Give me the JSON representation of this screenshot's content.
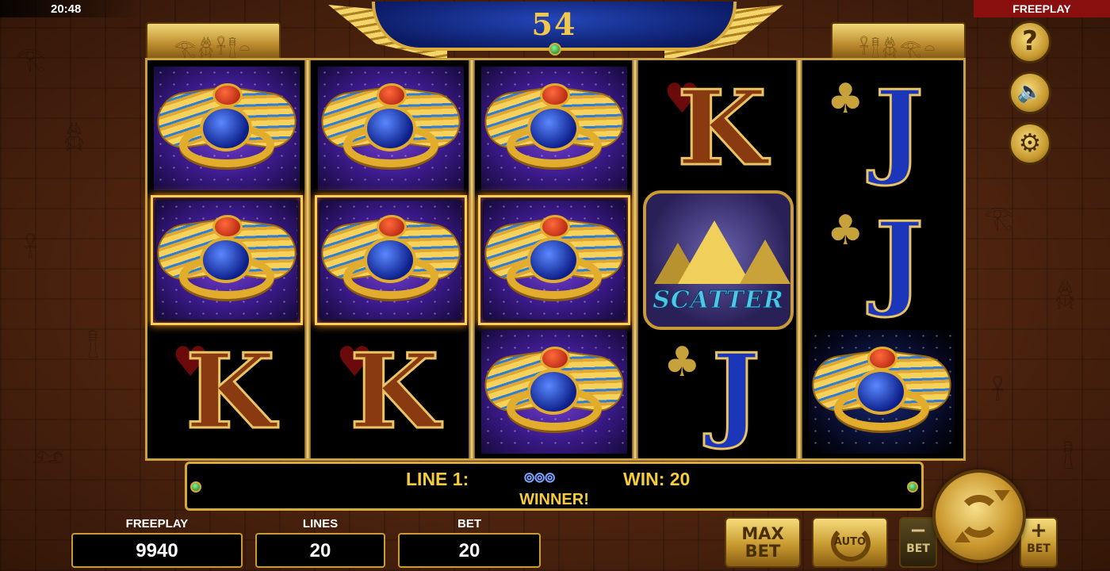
{
  "status": {
    "time": "20:48",
    "mode": "FREEPLAY"
  },
  "header": {
    "free_spins_count": "54",
    "left_cartouche": "𓂀𓆣𓋹𓊽𓏏",
    "right_cartouche": "𓋹𓊽𓆣𓂀𓏏"
  },
  "reels": [
    [
      "scarab",
      "scarab",
      "king"
    ],
    [
      "scarab",
      "scarab",
      "king"
    ],
    [
      "scarab",
      "scarab",
      "scarab"
    ],
    [
      "king",
      "scatter",
      "jack"
    ],
    [
      "jack",
      "jack",
      "scarab"
    ]
  ],
  "symbols": {
    "king": {
      "letter": "K",
      "suit": "♥"
    },
    "jack": {
      "letter": "J",
      "suit": "♣"
    },
    "scatter": {
      "word": "SCATTER"
    }
  },
  "win_line": {
    "label": "LINE 1:",
    "symbols_icon": "⊚⊚⊚",
    "win_label": "WIN: 20",
    "message": "WINNER!"
  },
  "bottom": {
    "credit_label": "FREEPLAY",
    "credit_value": "9940",
    "lines_label": "LINES",
    "lines_value": "20",
    "bet_label": "BET",
    "bet_value": "20"
  },
  "buttons": {
    "max_bet": "MAX\nBET",
    "auto": "AUTO",
    "bet_minus_sym": "−",
    "bet_minus_label": "BET",
    "bet_plus_sym": "+",
    "bet_plus_label": "BET",
    "help": "?",
    "sound": "🔈",
    "settings": "⚙"
  },
  "colors": {
    "gold": "#d6a93a",
    "win_text": "#f4cc3c",
    "mode_red": "#8a1010"
  }
}
